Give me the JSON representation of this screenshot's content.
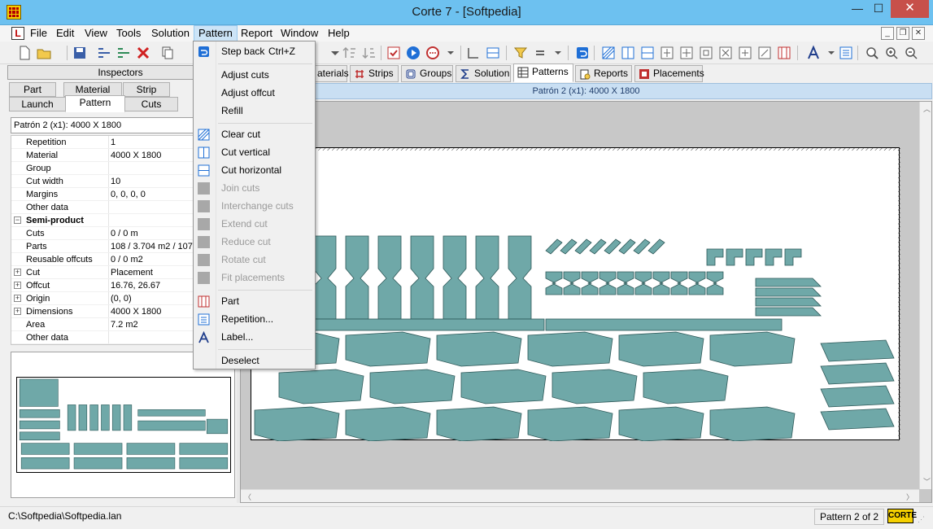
{
  "window": {
    "title": "Corte 7 - [Softpedia]"
  },
  "menubar": {
    "items": [
      "File",
      "Edit",
      "View",
      "Tools",
      "Solution",
      "Pattern",
      "Report",
      "Window",
      "Help"
    ],
    "active": "Pattern"
  },
  "inspectors": {
    "title": "Inspectors",
    "tabs_row1": [
      "Part",
      "Material",
      "Strip"
    ],
    "tabs_row2": [
      "Launch",
      "Pattern",
      "Cuts"
    ],
    "selected_tab": "Pattern",
    "pattern_field": "Patrón 2 (x1): 4000 X 1800",
    "rows": [
      {
        "label": "Repetition",
        "value": "1",
        "expander": ""
      },
      {
        "label": "Material",
        "value": "4000 X 1800",
        "expander": ""
      },
      {
        "label": "Group",
        "value": "",
        "expander": ""
      },
      {
        "label": "Cut width",
        "value": "10",
        "expander": ""
      },
      {
        "label": "Margins",
        "value": "0, 0, 0, 0",
        "expander": ""
      },
      {
        "label": "Other data",
        "value": "",
        "expander": ""
      },
      {
        "label": "Semi-product",
        "value": "",
        "expander": "−",
        "section": true
      },
      {
        "label": "Cuts",
        "value": "0 / 0 m",
        "expander": ""
      },
      {
        "label": "Parts",
        "value": "108 / 3.704 m2 / 107",
        "expander": ""
      },
      {
        "label": "Reusable offcuts",
        "value": "0 / 0 m2",
        "expander": ""
      },
      {
        "label": "Cut",
        "value": "Placement",
        "expander": "+"
      },
      {
        "label": "Offcut",
        "value": "16.76, 26.67",
        "expander": "+"
      },
      {
        "label": "Origin",
        "value": "(0, 0)",
        "expander": "+"
      },
      {
        "label": "Dimensions",
        "value": "4000 X 1800",
        "expander": "+"
      },
      {
        "label": "Area",
        "value": "7.2 m2",
        "expander": ""
      },
      {
        "label": "Other data",
        "value": "",
        "expander": ""
      }
    ]
  },
  "doc_tabs": [
    {
      "label": "aterials",
      "icon": "materials-icon"
    },
    {
      "label": "Strips",
      "icon": "strips-icon"
    },
    {
      "label": "Groups",
      "icon": "groups-icon"
    },
    {
      "label": "Solution",
      "icon": "sigma-icon"
    },
    {
      "label": "Patterns",
      "icon": "patterns-icon",
      "selected": true
    },
    {
      "label": "Reports",
      "icon": "reports-icon"
    },
    {
      "label": "Placements",
      "icon": "placements-icon"
    }
  ],
  "pattern_header": "Patrón 2 (x1): 4000 X 1800",
  "dropdown": {
    "items": [
      {
        "label": "Step back",
        "shortcut": "Ctrl+Z",
        "icon": "step-back-icon",
        "enabled": true
      },
      {
        "separator": true
      },
      {
        "label": "Adjust cuts",
        "enabled": true
      },
      {
        "label": "Adjust offcut",
        "enabled": true
      },
      {
        "label": "Refill",
        "enabled": true
      },
      {
        "separator": true
      },
      {
        "label": "Clear cut",
        "icon": "clear-cut-icon",
        "enabled": true
      },
      {
        "label": "Cut vertical",
        "icon": "cut-vertical-icon",
        "enabled": true
      },
      {
        "label": "Cut horizontal",
        "icon": "cut-horizontal-icon",
        "enabled": true
      },
      {
        "label": "Join cuts",
        "icon": "join-cuts-icon",
        "enabled": false
      },
      {
        "label": "Interchange cuts",
        "icon": "interchange-cuts-icon",
        "enabled": false
      },
      {
        "label": "Extend cut",
        "icon": "extend-cut-icon",
        "enabled": false
      },
      {
        "label": "Reduce cut",
        "icon": "reduce-cut-icon",
        "enabled": false
      },
      {
        "label": "Rotate cut",
        "icon": "rotate-cut-icon",
        "enabled": false
      },
      {
        "label": "Fit placements",
        "icon": "fit-placements-icon",
        "enabled": false
      },
      {
        "separator": true
      },
      {
        "label": "Part",
        "icon": "part-icon",
        "enabled": true
      },
      {
        "label": "Repetition...",
        "icon": "repetition-icon",
        "enabled": true
      },
      {
        "label": "Label...",
        "icon": "label-icon",
        "enabled": true
      },
      {
        "separator": true
      },
      {
        "label": "Deselect",
        "enabled": true
      }
    ]
  },
  "statusbar": {
    "path": "C:\\Softpedia\\Softpedia.lan",
    "pattern_count": "Pattern 2 of 2",
    "logo_text": "CORTE"
  },
  "colors": {
    "title_bar": "#6dc1f0",
    "part_fill": "#6fa8a8",
    "part_stroke": "#2d5858",
    "close_button": "#c7504a",
    "active_menu": "#cce4f7",
    "pattern_header": "#c9dff3"
  }
}
